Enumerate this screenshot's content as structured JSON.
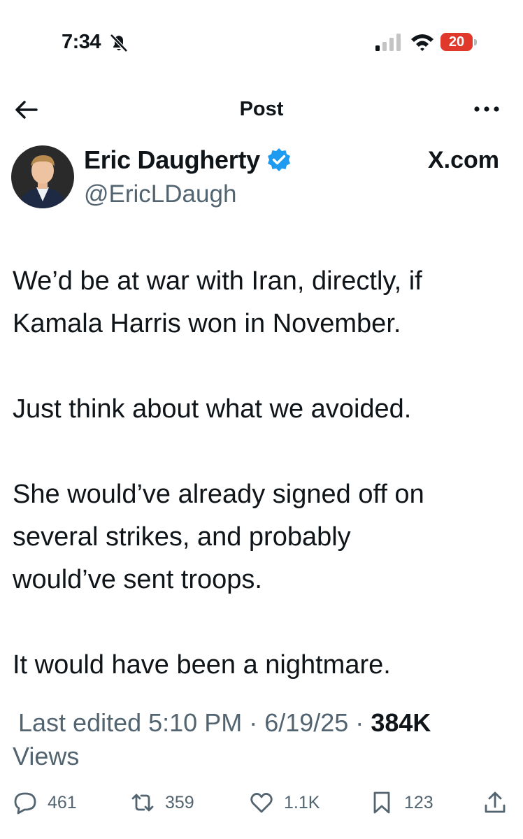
{
  "status_bar": {
    "time": "7:34",
    "battery": "20"
  },
  "nav": {
    "title": "Post"
  },
  "author": {
    "name": "Eric Daugherty",
    "handle": "@EricLDaugh",
    "watermark": "X.com"
  },
  "tweet": {
    "paragraphs": [
      "We’d be at war with Iran, directly, if\nKamala Harris won in November.",
      "Just think about what we avoided.",
      "She would’ve already signed off on\nseveral strikes, and probably\nwould’ve sent troops.",
      "It would have been a nightmare."
    ]
  },
  "meta": {
    "edited": "Last edited 5:10 PM · 6/19/25 · ",
    "views_count": "384K",
    "views_label": "Views"
  },
  "actions": {
    "replies": "461",
    "reposts": "359",
    "likes": "1.1K",
    "bookmarks": "123"
  },
  "colors": {
    "text": "#0f1419",
    "secondary": "#536471",
    "verified": "#1d9bf0",
    "battery": "#e0392b"
  }
}
